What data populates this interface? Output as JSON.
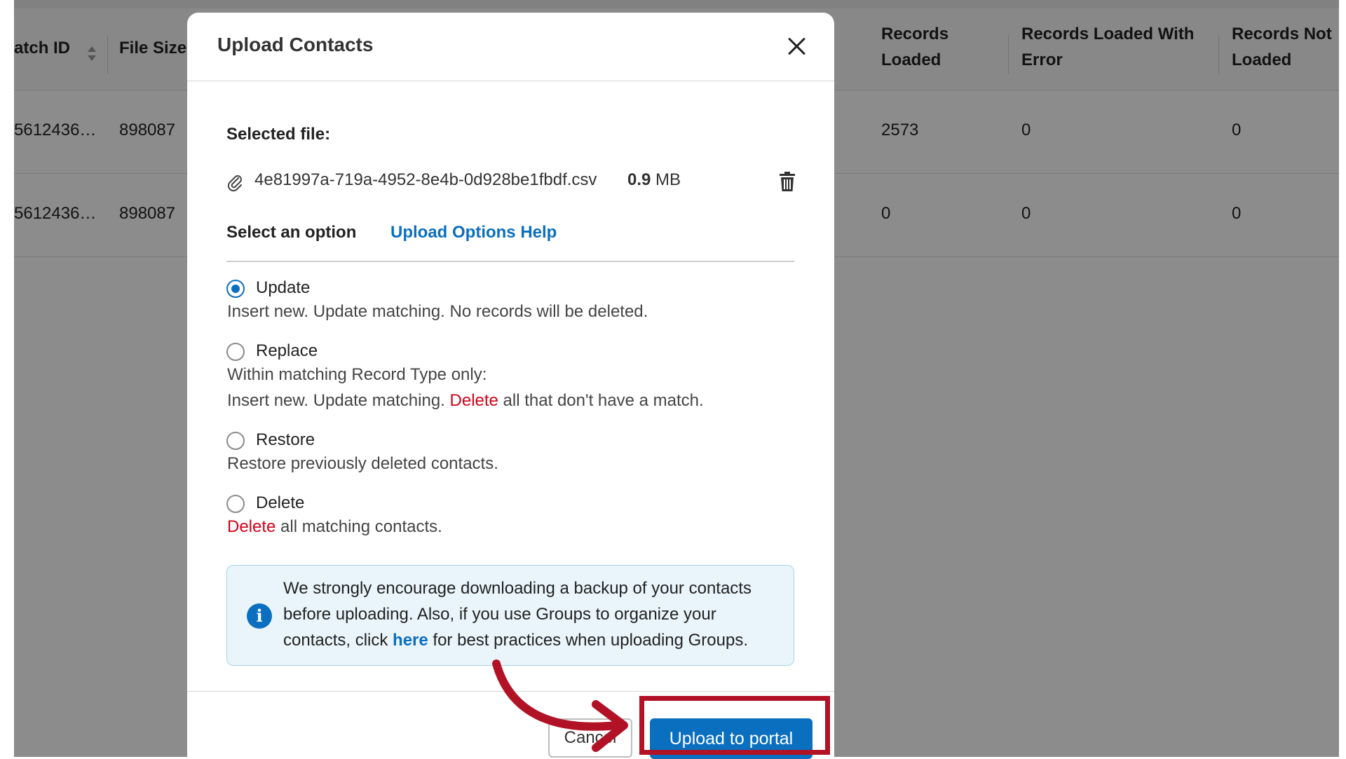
{
  "table": {
    "headers": [
      "atch ID",
      "File Size",
      "Records\nLoaded",
      "Records Loaded With\nError",
      "Records Not\nLoaded"
    ],
    "header_records_loaded_1": "Records",
    "header_records_loaded_2": "Loaded",
    "header_with_error_1": "Records Loaded With",
    "header_with_error_2": "Error",
    "header_not_loaded_1": "Records Not",
    "header_not_loaded_2": "Loaded",
    "header_batch_id": "atch ID",
    "header_file_size": "File Size",
    "rows": [
      {
        "batch_id": "5612436…",
        "file_size": "898087",
        "records_loaded": "2573",
        "with_error": "0",
        "not_loaded": "0"
      },
      {
        "batch_id": "5612436…",
        "file_size": "898087",
        "records_loaded": "0",
        "with_error": "0",
        "not_loaded": "0"
      }
    ]
  },
  "modal": {
    "title": "Upload Contacts",
    "selected_file_label": "Selected file:",
    "file_name": "4e81997a-719a-4952-8e4b-0d928be1fbdf.csv",
    "file_size_value": "0.9",
    "file_size_unit": "MB",
    "select_option_label": "Select an option",
    "help_link": "Upload Options Help",
    "options": [
      {
        "label": "Update",
        "checked": true,
        "desc1": "Insert new. Update matching. No records will be deleted."
      },
      {
        "label": "Replace",
        "checked": false,
        "desc1": "Within matching Record Type only:",
        "desc2_a": "Insert new. Update matching. ",
        "desc2_danger": "Delete",
        "desc2_b": " all that don't have a match."
      },
      {
        "label": "Restore",
        "checked": false,
        "desc1": "Restore previously deleted contacts."
      },
      {
        "label": "Delete",
        "checked": false,
        "desc_danger": "Delete",
        "desc_rest": " all matching contacts."
      }
    ],
    "info": {
      "text_a": "We strongly encourage downloading a backup of your contacts before uploading. Also, if you use Groups to organize your contacts, click ",
      "link": "here",
      "text_b": " for best practices when uploading Groups."
    },
    "cancel_label": "Cancel",
    "upload_label": "Upload to portal"
  },
  "colors": {
    "accent": "#0b6fbf",
    "danger": "#d0021b",
    "highlight": "#b11226"
  }
}
